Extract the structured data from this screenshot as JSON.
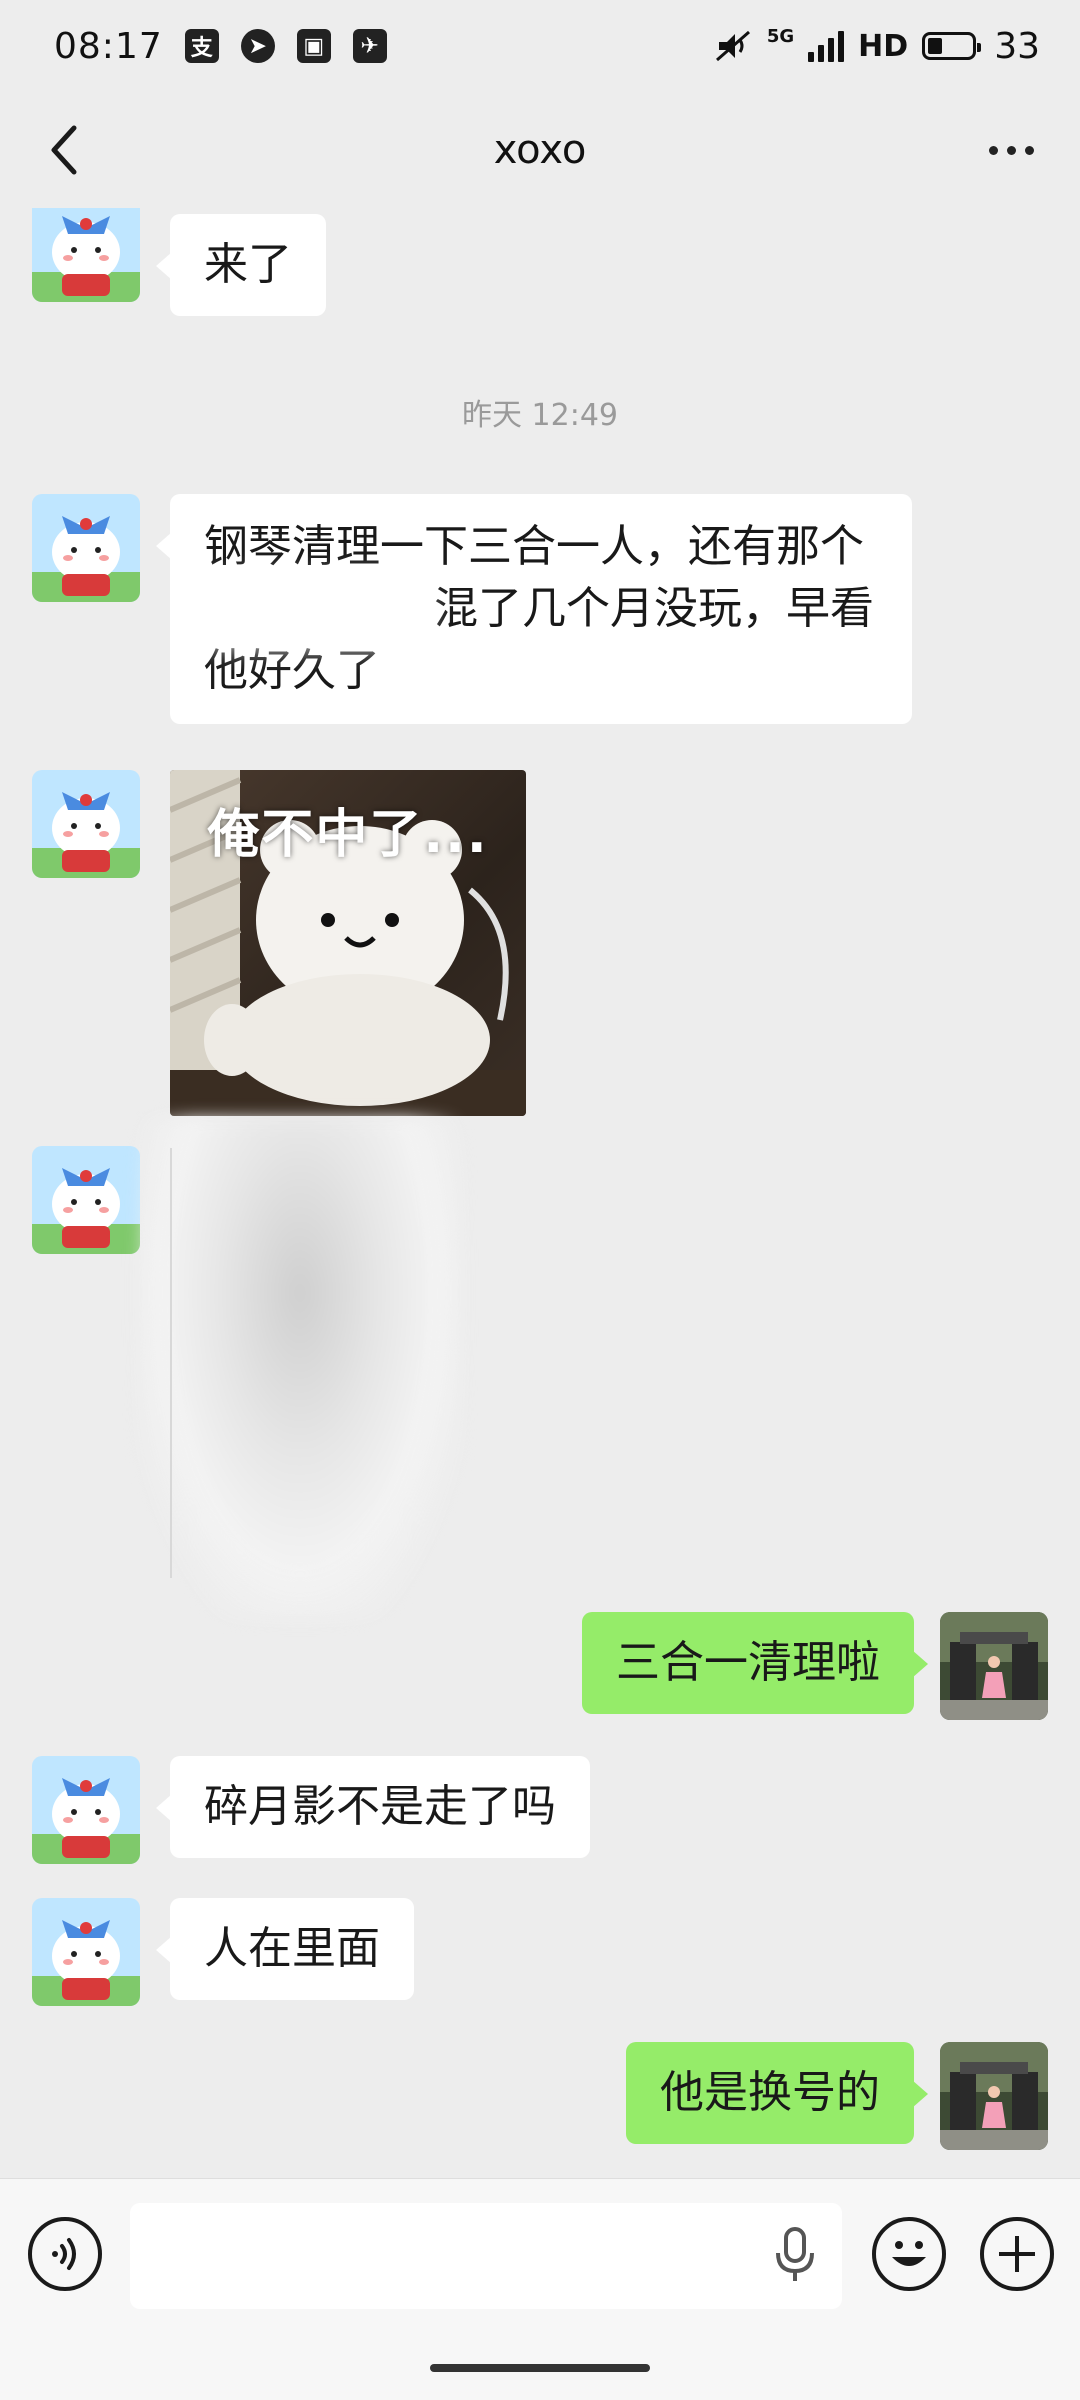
{
  "status_bar": {
    "time": "08:17",
    "app_icons": [
      "alipay-icon",
      "app-icon",
      "news-icon",
      "telegram-icon"
    ],
    "network": "5G",
    "hd": "HD",
    "battery": "33",
    "battery_level": 0.33
  },
  "header": {
    "title": "xoxo",
    "back_icon": "chevron-left-icon",
    "more_icon": "more-icon"
  },
  "chat": {
    "messages": [
      {
        "side": "left",
        "type": "text",
        "text": "来了"
      },
      {
        "type": "timestamp",
        "text": "昨天 12:49"
      },
      {
        "side": "left",
        "type": "text",
        "lines": [
          "钢琴清理一下三合一人，还有那个",
          "混了几个月没玩，早看",
          "他好久了"
        ]
      },
      {
        "side": "left",
        "type": "sticker",
        "caption": "俺不中了..."
      },
      {
        "side": "left",
        "type": "image-blurred"
      },
      {
        "side": "right",
        "type": "text",
        "text": "三合一清理啦"
      },
      {
        "side": "left",
        "type": "text",
        "text": "碎月影不是走了吗"
      },
      {
        "side": "left",
        "type": "text",
        "text": "人在里面"
      },
      {
        "side": "right",
        "type": "text",
        "text": "他是换号的"
      }
    ]
  },
  "input_bar": {
    "voice_icon": "voice-icon",
    "input_value": "",
    "mic_icon": "mic-icon",
    "emoji_icon": "emoji-icon",
    "plus_icon": "plus-icon"
  },
  "colors": {
    "background": "#ededed",
    "bubble_in": "#ffffff",
    "bubble_out": "#95ec69",
    "timestamp": "#9a9a9a"
  }
}
